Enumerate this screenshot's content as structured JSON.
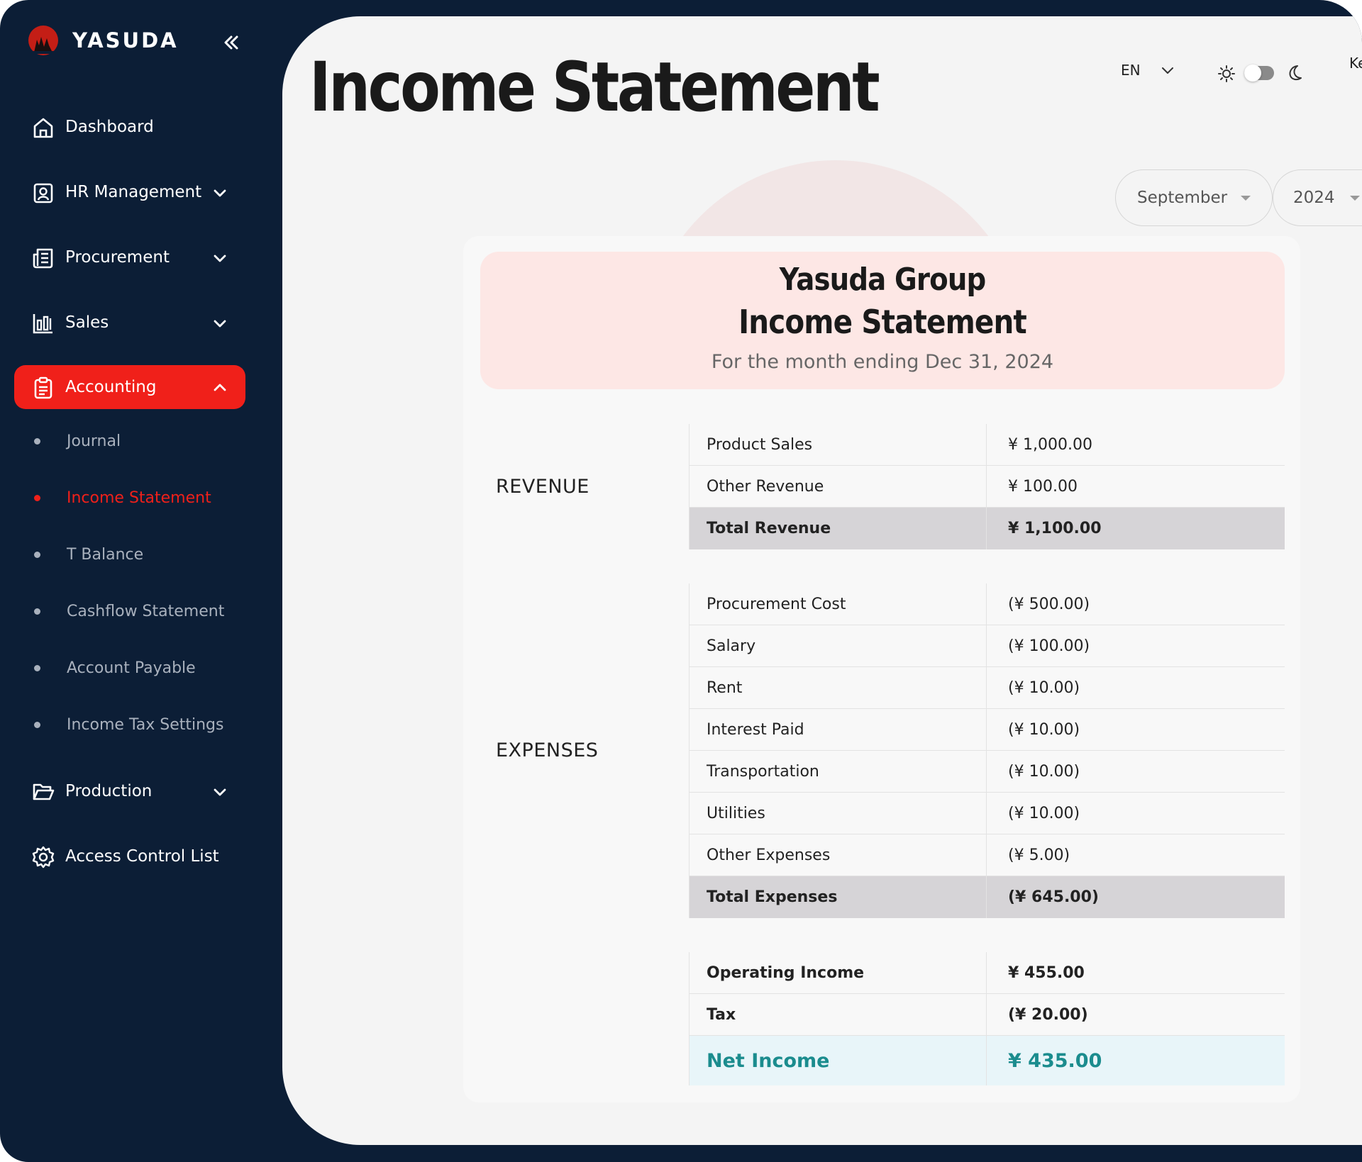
{
  "sidebar": {
    "brand": "YASUDA",
    "nav": [
      {
        "label": "Dashboard"
      },
      {
        "label": "HR Management"
      },
      {
        "label": "Procurement"
      },
      {
        "label": "Sales"
      },
      {
        "label": "Accounting"
      },
      {
        "label": "Production"
      },
      {
        "label": "Access Control List"
      }
    ],
    "accounting_sub": [
      {
        "label": "Journal"
      },
      {
        "label": "Income Statement"
      },
      {
        "label": "T Balance"
      },
      {
        "label": "Cashflow Statement"
      },
      {
        "label": "Account Payable"
      },
      {
        "label": "Income Tax Settings"
      }
    ]
  },
  "header": {
    "title": "Income Statement",
    "language": "EN",
    "user_initial": "Ke"
  },
  "filters": {
    "month": "September",
    "year": "2024"
  },
  "statement": {
    "company": "Yasuda Group",
    "title": "Income Statement",
    "period": "For the month ending Dec 31, 2024",
    "revenue": {
      "label": "REVENUE",
      "rows": [
        {
          "name": "Product Sales",
          "value": "¥ 1,000.00"
        },
        {
          "name": "Other Revenue",
          "value": "¥ 100.00"
        }
      ],
      "total": {
        "name": "Total Revenue",
        "value": "¥ 1,100.00"
      }
    },
    "expenses": {
      "label": "EXPENSES",
      "rows": [
        {
          "name": "Procurement Cost",
          "value": "(¥ 500.00)"
        },
        {
          "name": "Salary",
          "value": "(¥ 100.00)"
        },
        {
          "name": "Rent",
          "value": "(¥ 10.00)"
        },
        {
          "name": "Interest Paid",
          "value": "(¥ 10.00)"
        },
        {
          "name": "Transportation",
          "value": "(¥ 10.00)"
        },
        {
          "name": "Utilities",
          "value": "(¥ 10.00)"
        },
        {
          "name": "Other Expenses",
          "value": "(¥ 5.00)"
        }
      ],
      "total": {
        "name": "Total Expenses",
        "value": "(¥ 645.00)"
      }
    },
    "summary": {
      "operating": {
        "name": "Operating Income",
        "value": "¥ 455.00"
      },
      "tax": {
        "name": "Tax",
        "value": "(¥ 20.00)"
      },
      "net": {
        "name": "Net Income",
        "value": "¥ 435.00"
      }
    }
  },
  "colors": {
    "sidebar_bg": "#0c1e36",
    "accent": "#f0201a",
    "net_income": "#1b8c8e"
  }
}
